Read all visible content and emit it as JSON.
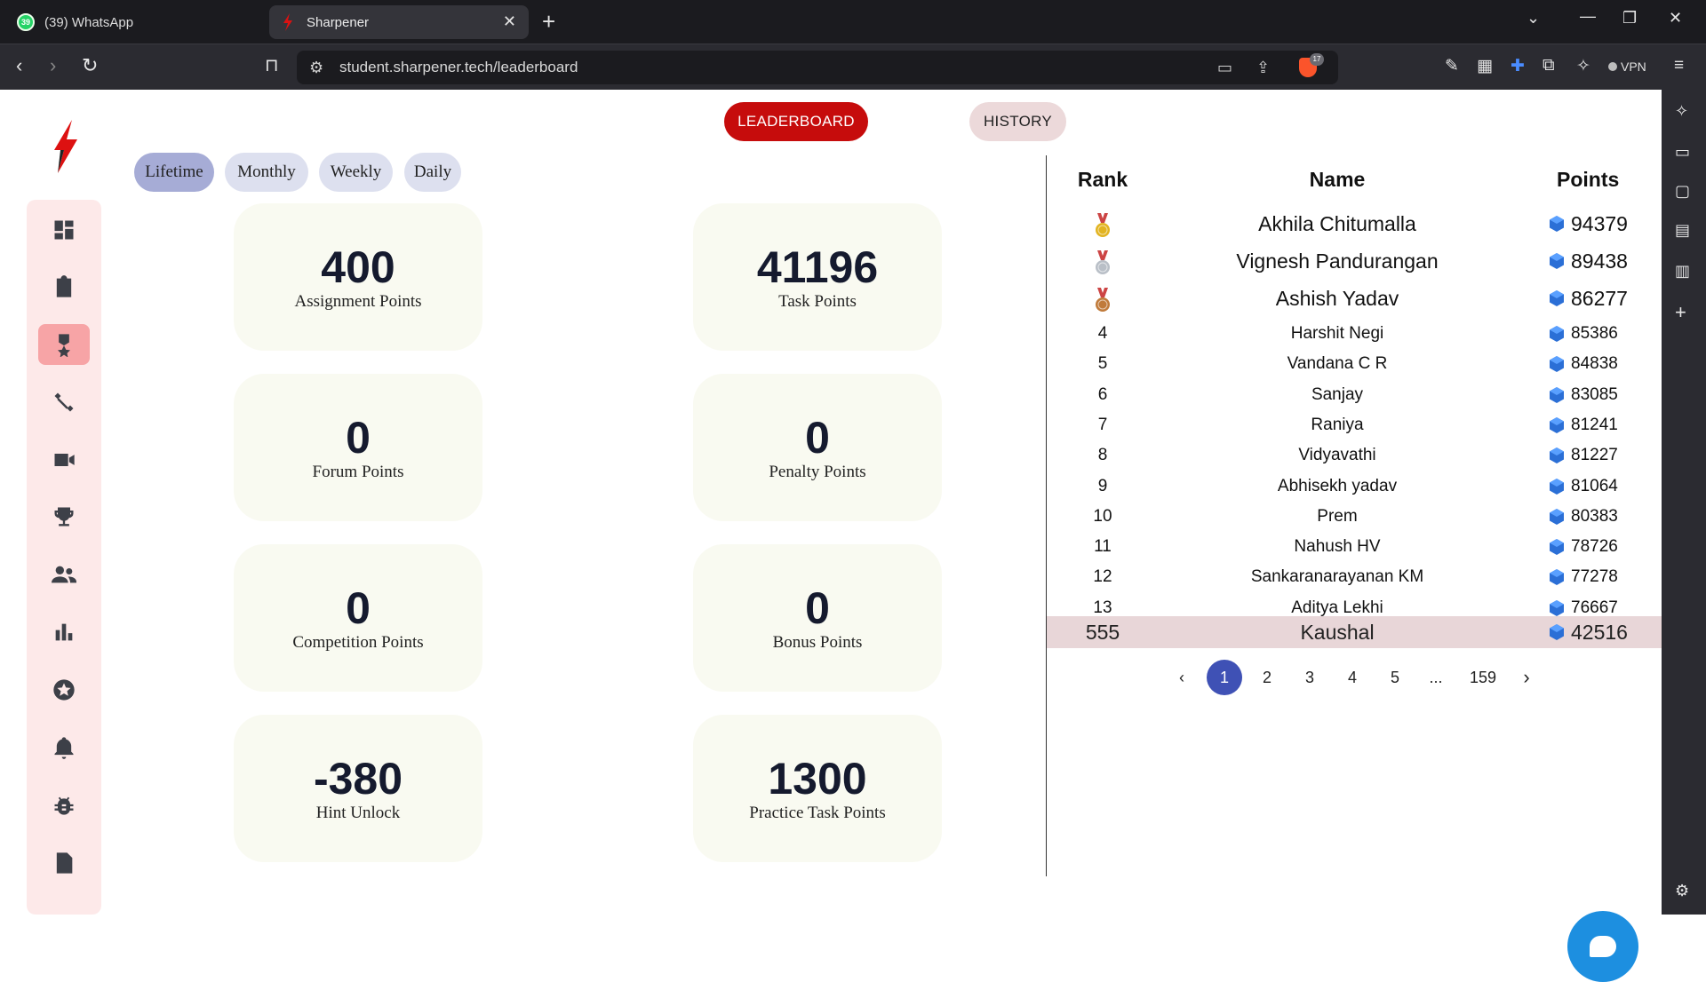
{
  "browser": {
    "tabs": [
      {
        "title": "(39) WhatsApp",
        "badge": "39"
      },
      {
        "title": "Sharpener"
      }
    ],
    "url": "student.sharpener.tech/leaderboard",
    "brave_badge": "17",
    "vpn_label": "VPN"
  },
  "header": {
    "leaderboard_label": "LEADERBOARD",
    "history_label": "HISTORY"
  },
  "filters": [
    "Lifetime",
    "Monthly",
    "Weekly",
    "Daily"
  ],
  "active_filter": "Lifetime",
  "sidebar": {
    "items": [
      "dashboard-icon",
      "assignment-icon",
      "leaderboard-icon",
      "practice-icon",
      "video-icon",
      "trophy-icon",
      "community-icon",
      "stats-icon",
      "star-icon",
      "notification-icon",
      "bug-icon",
      "task-icon"
    ],
    "active": "leaderboard-icon"
  },
  "points": [
    {
      "value": "400",
      "label": "Assignment Points"
    },
    {
      "value": "41196",
      "label": "Task Points"
    },
    {
      "value": "0",
      "label": "Forum Points"
    },
    {
      "value": "0",
      "label": "Penalty Points"
    },
    {
      "value": "0",
      "label": "Competition Points"
    },
    {
      "value": "0",
      "label": "Bonus Points"
    },
    {
      "value": "-380",
      "label": "Hint Unlock"
    },
    {
      "value": "1300",
      "label": "Practice Task Points"
    }
  ],
  "leaderboard": {
    "headers": {
      "rank": "Rank",
      "name": "Name",
      "points": "Points"
    },
    "rows": [
      {
        "rank": "",
        "medal": "gold-medal-icon",
        "name": "Akhila Chitumalla",
        "points": "94379"
      },
      {
        "rank": "",
        "medal": "silver-medal-icon",
        "name": "Vignesh Pandurangan",
        "points": "89438"
      },
      {
        "rank": "",
        "medal": "bronze-medal-icon",
        "name": "Ashish Yadav",
        "points": "86277"
      },
      {
        "rank": "4",
        "name": "Harshit Negi",
        "points": "85386"
      },
      {
        "rank": "5",
        "name": "Vandana C R",
        "points": "84838"
      },
      {
        "rank": "6",
        "name": "Sanjay",
        "points": "83085"
      },
      {
        "rank": "7",
        "name": "Raniya",
        "points": "81241"
      },
      {
        "rank": "8",
        "name": "Vidyavathi",
        "points": "81227"
      },
      {
        "rank": "9",
        "name": "Abhisekh yadav",
        "points": "81064"
      },
      {
        "rank": "10",
        "name": "Prem",
        "points": "80383"
      },
      {
        "rank": "11",
        "name": "Nahush HV",
        "points": "78726"
      },
      {
        "rank": "12",
        "name": "Sankaranarayanan KM",
        "points": "77278"
      },
      {
        "rank": "13",
        "name": "Aditya Lekhi",
        "points": "76667"
      }
    ],
    "current_user": {
      "rank": "555",
      "name": "Kaushal",
      "points": "42516"
    }
  },
  "pagination": {
    "pages": [
      "1",
      "2",
      "3",
      "4",
      "5",
      "...",
      "159"
    ],
    "active": "1"
  },
  "colors": {
    "accent_red": "#c60c0c",
    "nav_bg": "#fde9e9",
    "nav_active": "#f7a4a6",
    "filter_active": "#a6acd6",
    "pagination_active": "#3f51b5",
    "chat_fab": "#1d8fe0"
  }
}
